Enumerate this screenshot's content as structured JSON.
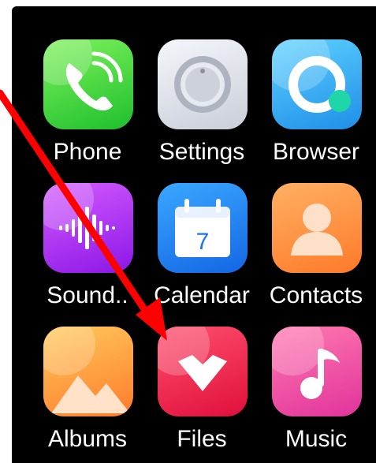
{
  "apps": [
    {
      "label": "Phone",
      "icon": "phone-icon",
      "color_top": "#7df25a",
      "color_bottom": "#1fbf2e"
    },
    {
      "label": "Settings",
      "icon": "settings-knob-icon",
      "color_top": "#f4f6fa",
      "color_bottom": "#c9ced8"
    },
    {
      "label": "Browser",
      "icon": "browser-ring-icon",
      "color_top": "#5ed2ff",
      "color_bottom": "#1f8ee8"
    },
    {
      "label": "Sound..",
      "icon": "sound-wave-icon",
      "color_top": "#d55bff",
      "color_bottom": "#8b17e6"
    },
    {
      "label": "Calendar",
      "icon": "calendar-icon",
      "color_top": "#3aa8ff",
      "color_bottom": "#1466e4",
      "day": "7"
    },
    {
      "label": "Contacts",
      "icon": "person-icon",
      "color_top": "#ffb064",
      "color_bottom": "#ff7a28"
    },
    {
      "label": "Albums",
      "icon": "mountains-icon",
      "color_top": "#ffcb5c",
      "color_bottom": "#ff7a2c"
    },
    {
      "label": "Files",
      "icon": "heart-folder-icon",
      "color_top": "#ff4f6e",
      "color_bottom": "#e0103a"
    },
    {
      "label": "Music",
      "icon": "music-note-icon",
      "color_top": "#ff7ab0",
      "color_bottom": "#e1339b"
    }
  ],
  "annotation": {
    "arrow_color": "#ff0000",
    "target": "Files"
  }
}
